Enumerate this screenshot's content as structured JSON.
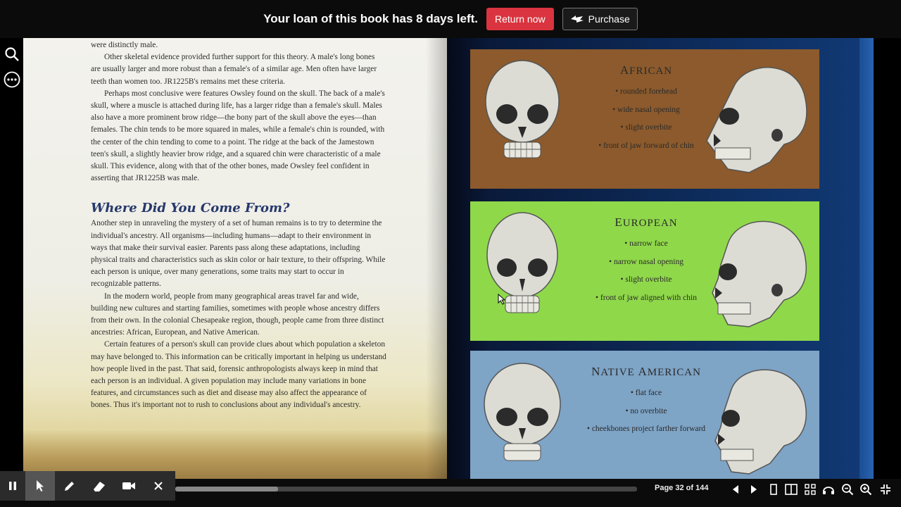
{
  "banner": {
    "loan_text": "Your loan of this book has 8 days left.",
    "return_label": "Return now",
    "purchase_label": "Purchase"
  },
  "left_page": {
    "paragraphs_top": [
      {
        "indent": false,
        "text": "were distinctly male."
      },
      {
        "indent": true,
        "text": "Other skeletal evidence provided further support for this theory. A male's long bones are usually larger and more robust than a female's of a similar age. Men often have larger teeth than women too. JR1225B's remains met these criteria."
      },
      {
        "indent": true,
        "text": "Perhaps most conclusive were features Owsley found on the skull. The back of a male's skull, where a muscle is attached during life, has a larger ridge than a female's skull. Males also have a more prominent brow ridge—the bony part of the skull above the eyes—than females. The chin tends to be more squared in males, while a female's chin is rounded, with the center of the chin tending to come to a point. The ridge at the back of the Jamestown teen's skull, a slightly heavier brow ridge, and a squared chin were characteristic of a male skull. This evidence, along with that of the other bones, made Owsley feel confident in asserting that JR1225B was male."
      }
    ],
    "heading": "Where Did You Come From?",
    "paragraphs_bottom": [
      {
        "indent": false,
        "text": "Another step in unraveling the mystery of a set of human remains is to try to determine the individual's ancestry. All organisms—including humans—adapt to their environment in ways that make their survival easier. Parents pass along these adaptations, including physical traits and characteristics such as skin color or hair texture, to their offspring. While each person is unique, over many generations, some traits may start to occur in recognizable patterns."
      },
      {
        "indent": true,
        "text": "In the modern world, people from many geographical areas travel far and wide, building new cultures and starting families, sometimes with people whose ancestry differs from their own. In the colonial Chesapeake region, though, people came from three distinct ancestries: African, European, and Native American."
      },
      {
        "indent": true,
        "text": "Certain features of a person's skull can provide clues about which population a skeleton may have belonged to. This information can be critically important in helping us understand how people lived in the past. That said, forensic anthropologists always keep in mind that each person is an individual. A given population may include many variations in bone features, and circumstances such as diet and disease may also affect the appearance of bones. Thus it's important not to rush to conclusions about any individual's ancestry."
      }
    ]
  },
  "right_page": {
    "panels": [
      {
        "title": "African",
        "color": "#8c5a2c",
        "traits": [
          "• rounded forehead",
          "• wide nasal opening",
          "• slight overbite",
          "• front of jaw forward of chin"
        ]
      },
      {
        "title": "European",
        "color": "#8fd84a",
        "traits": [
          "• narrow face",
          "• narrow nasal opening",
          "• slight overbite",
          "• front of jaw aligned with chin"
        ]
      },
      {
        "title": "Native American",
        "color": "#7ea4c6",
        "traits": [
          "• flat face",
          "• no overbite",
          "• cheekbones project farther forward"
        ]
      }
    ]
  },
  "toolbar": {
    "page_indicator": "Page 32 of 144",
    "progress_fraction": 0.222,
    "tools": [
      "pause-icon",
      "pointer-icon",
      "pen-icon",
      "eraser-icon",
      "video-icon",
      "close-icon"
    ],
    "controls": [
      "prev-page-icon",
      "next-page-icon",
      "one-page-view-icon",
      "two-page-view-icon",
      "thumbnail-view-icon",
      "read-aloud-icon",
      "zoom-out-icon",
      "zoom-in-icon",
      "exit-fullscreen-icon"
    ]
  },
  "sidebar": {
    "icons": [
      "search-icon",
      "more-options-icon"
    ]
  }
}
